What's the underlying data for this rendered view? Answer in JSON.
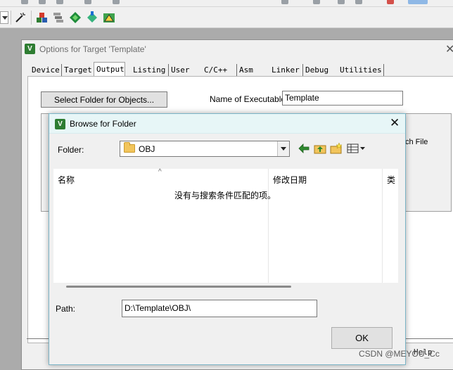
{
  "ide": {
    "icons": [
      "select-dropdown",
      "wand-icon",
      "build-target-icon",
      "rebuild-icon",
      "download-icon",
      "options-icon",
      "pack-installer-icon"
    ]
  },
  "options_window": {
    "title": "Options for Target 'Template'",
    "tabs": [
      {
        "label": "Device"
      },
      {
        "label": "Target"
      },
      {
        "label": "Output"
      },
      {
        "label": "Listing"
      },
      {
        "label": "User"
      },
      {
        "label": "C/C++"
      },
      {
        "label": "Asm"
      },
      {
        "label": "Linker"
      },
      {
        "label": "Debug"
      },
      {
        "label": "Utilities"
      }
    ],
    "active_tab": "Output",
    "select_folder_button": "Select Folder for Objects...",
    "executable_label": "Name of Executable:",
    "executable_value": "Template",
    "partial_text": "ch File",
    "help_ghost": "Help"
  },
  "browse_dialog": {
    "title": "Browse for Folder",
    "folder_label": "Folder:",
    "folder_value": "OBJ",
    "columns": {
      "name": "名称",
      "date_modified": "修改日期",
      "type": "类"
    },
    "empty_message": "没有与搜索条件匹配的项。",
    "path_label": "Path:",
    "path_value": "D:\\Template\\OBJ\\",
    "ok_button": "OK",
    "close_glyph": "✕"
  },
  "watermark": "CSDN @MEYOU_Cc",
  "colors": {
    "dialog_title_bg": "#e7f6f7",
    "app_icon_green": "#2e7d32",
    "background_dim": "#ababab"
  }
}
